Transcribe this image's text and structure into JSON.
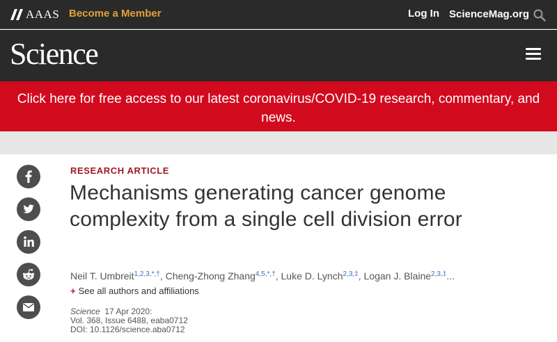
{
  "header": {
    "org_name": "AAAS",
    "become_member": "Become a Member",
    "login": "Log In",
    "site_link": "ScienceMag.org",
    "wordmark": "Science",
    "colors": {
      "bar": "#2a2a2a",
      "accent": "#e2a23a"
    }
  },
  "banner": {
    "text": "Click here for free access to our latest coronavirus/COVID-19 research, commentary, and news.",
    "color": "#d20a1e"
  },
  "share": {
    "icons": [
      "facebook-icon",
      "twitter-icon",
      "linkedin-icon",
      "reddit-icon",
      "email-icon"
    ]
  },
  "article": {
    "kicker": "RESEARCH ARTICLE",
    "title": "Mechanisms generating cancer genome complexity from a single cell division error",
    "authors": [
      {
        "name": "Neil T. Umbreit",
        "sup": "1,2,3,*,†"
      },
      {
        "name": "Cheng-Zhong Zhang",
        "sup": "4,5,*,†"
      },
      {
        "name": "Luke D. Lynch",
        "sup": "2,3,‡"
      },
      {
        "name": "Logan J. Blaine",
        "sup": "2,3,‡"
      }
    ],
    "authors_more": "...",
    "see_all": "See all authors and affiliations",
    "journal": "Science",
    "date": "17 Apr 2020:",
    "volume": "Vol. 368, Issue 6488, eaba0712",
    "doi": "DOI: 10.1126/science.aba0712"
  }
}
